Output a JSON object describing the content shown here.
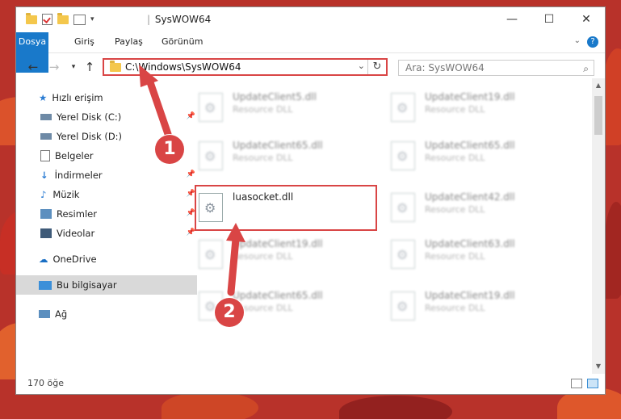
{
  "window": {
    "title": "SysWOW64"
  },
  "ribbon": {
    "tabs": [
      "Dosya",
      "Giriş",
      "Paylaş",
      "Görünüm"
    ]
  },
  "address": {
    "path": "C:\\Windows\\SysWOW64"
  },
  "search": {
    "placeholder": "Ara: SysWOW64"
  },
  "sidebar": {
    "items": [
      {
        "label": "Hızlı erişim",
        "icon": "star-icon"
      },
      {
        "label": "Yerel Disk (C:)",
        "icon": "drive-icon",
        "pinned": true
      },
      {
        "label": "Yerel Disk (D:)",
        "icon": "drive-icon"
      },
      {
        "label": "Belgeler",
        "icon": "documents-icon"
      },
      {
        "label": "İndirmeler",
        "icon": "download-icon",
        "pinned": true
      },
      {
        "label": "Müzik",
        "icon": "music-icon",
        "pinned": true
      },
      {
        "label": "Resimler",
        "icon": "pictures-icon",
        "pinned": true
      },
      {
        "label": "Videolar",
        "icon": "video-icon",
        "pinned": true
      },
      {
        "label": "OneDrive",
        "icon": "cloud-icon"
      },
      {
        "label": "Bu bilgisayar",
        "icon": "computer-icon",
        "selected": true
      },
      {
        "label": "Ağ",
        "icon": "network-icon"
      }
    ]
  },
  "files": {
    "left": [
      {
        "name": "UpdateClient5.dll",
        "type": "Resource DLL"
      },
      {
        "name": "UpdateClient65.dll",
        "type": "Resource DLL"
      },
      {
        "name": "luasocket.dll",
        "type": ""
      },
      {
        "name": "UpdateClient19.dll",
        "type": "Resource DLL"
      },
      {
        "name": "UpdateClient65.dll",
        "type": "Resource DLL"
      }
    ],
    "right": [
      {
        "name": "UpdateClient19.dll",
        "type": "Resource DLL"
      },
      {
        "name": "UpdateClient65.dll",
        "type": "Resource DLL"
      },
      {
        "name": "UpdateClient42.dll",
        "type": "Resource DLL"
      },
      {
        "name": "UpdateClient63.dll",
        "type": "Resource DLL"
      },
      {
        "name": "UpdateClient19.dll",
        "type": "Resource DLL"
      }
    ]
  },
  "status": {
    "count": "170 öğe"
  },
  "annotations": {
    "step1": "1",
    "step2": "2"
  },
  "colors": {
    "accent": "#1979ca",
    "highlight": "#d94545"
  }
}
